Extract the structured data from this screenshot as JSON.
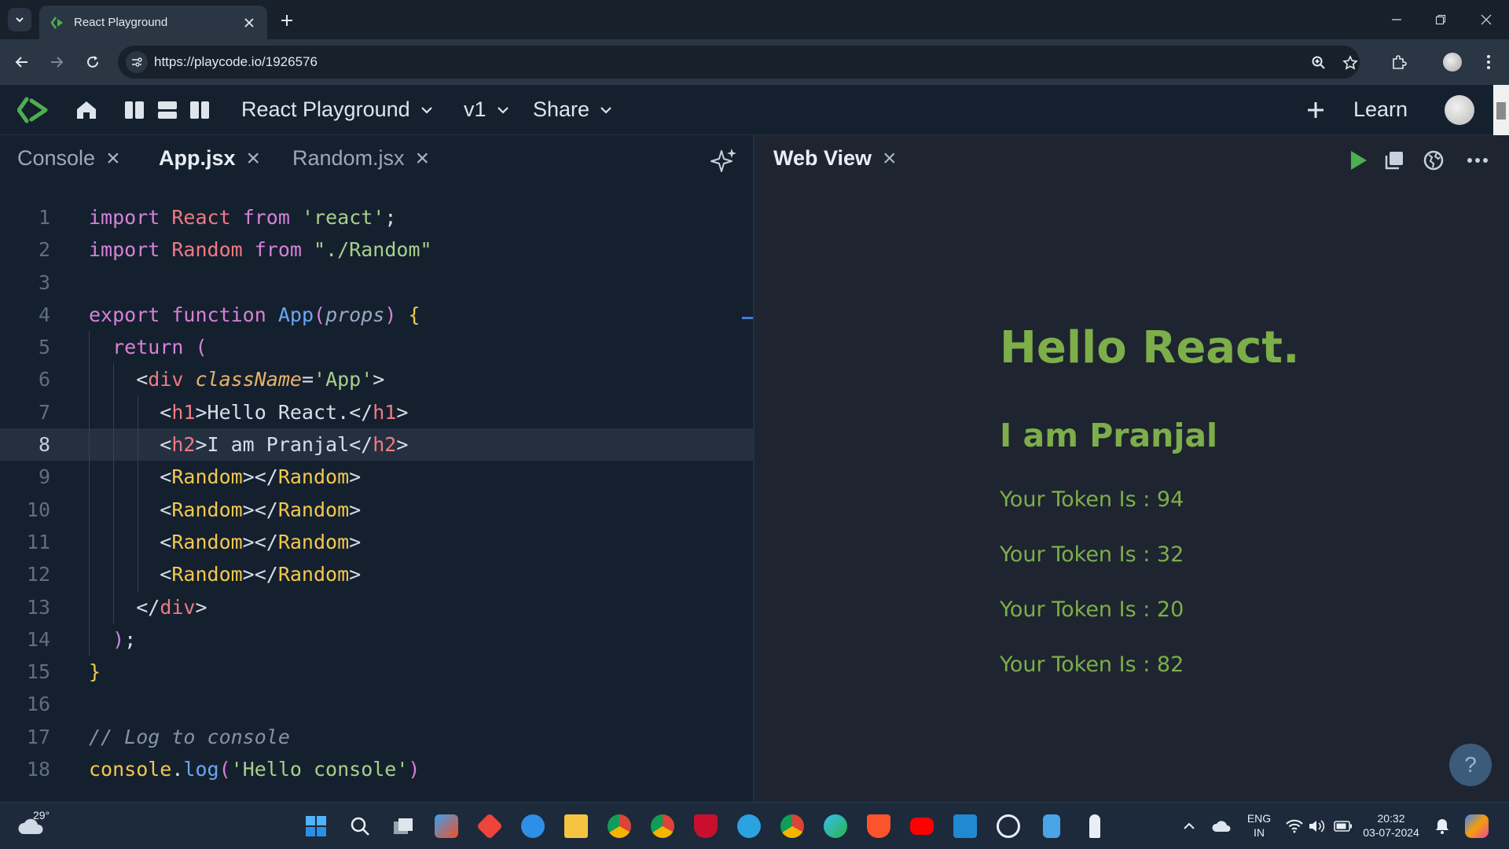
{
  "browser": {
    "tab_title": "React Playground",
    "url": "https://playcode.io/1926576"
  },
  "app_header": {
    "project_name": "React Playground",
    "version": "v1",
    "share_label": "Share",
    "learn_label": "Learn"
  },
  "editor": {
    "tabs": [
      {
        "label": "Console",
        "active": false
      },
      {
        "label": "App.jsx",
        "active": true
      },
      {
        "label": "Random.jsx",
        "active": false
      }
    ],
    "current_line": 8,
    "line_numbers": [
      "1",
      "2",
      "3",
      "4",
      "5",
      "6",
      "7",
      "8",
      "9",
      "10",
      "11",
      "12",
      "13",
      "14",
      "15",
      "16",
      "17",
      "18"
    ]
  },
  "web_view": {
    "tab_label": "Web View",
    "heading": "Hello React.",
    "subheading": "I am Pranjal",
    "tokens": [
      "Your Token Is : 94",
      "Your Token Is : 32",
      "Your Token Is : 20",
      "Your Token Is : 82"
    ],
    "help_label": "?"
  },
  "taskbar": {
    "temperature": "29°",
    "language_line1": "ENG",
    "language_line2": "IN",
    "time": "20:32",
    "date": "03-07-2024"
  },
  "colors": {
    "editor_bg": "#15202f",
    "preview_text": "#7dae4a",
    "accent_green": "#4caf50"
  }
}
